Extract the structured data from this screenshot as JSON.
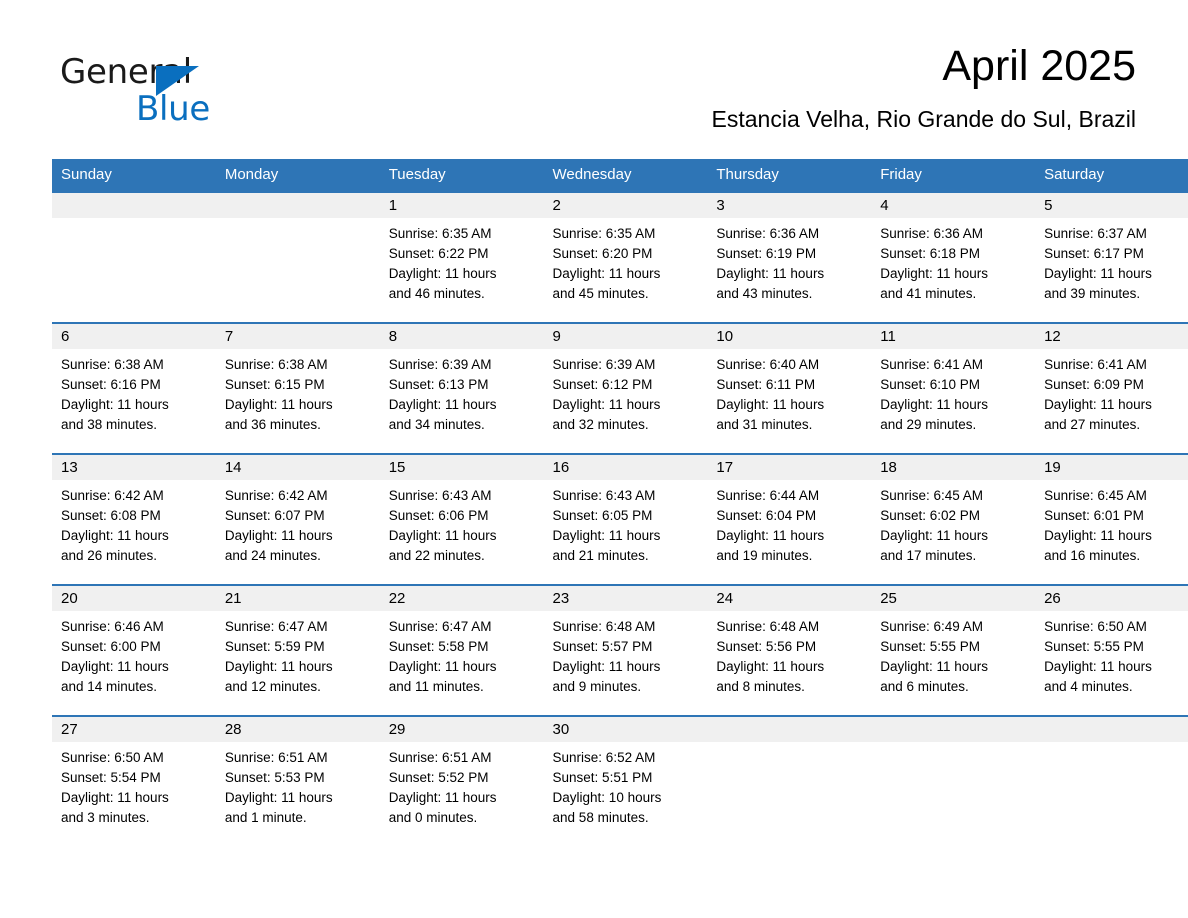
{
  "logo": {
    "text_primary": "General",
    "text_secondary": "Blue",
    "primary_color": "#1a1a1a",
    "secondary_color": "#0A6FBF"
  },
  "header": {
    "title": "April 2025",
    "subtitle": "Estancia Velha, Rio Grande do Sul, Brazil"
  },
  "theme": {
    "header_blue": "#2E75B6",
    "daynum_band_gray": "#F0F0F0",
    "row_divider_blue": "#2E75B6",
    "text_black": "#000000",
    "page_background": "#FFFFFF"
  },
  "calendar": {
    "weekday_headers": [
      "Sunday",
      "Monday",
      "Tuesday",
      "Wednesday",
      "Thursday",
      "Friday",
      "Saturday"
    ],
    "weeks": [
      [
        {
          "day": "",
          "lines": []
        },
        {
          "day": "",
          "lines": []
        },
        {
          "day": "1",
          "lines": [
            "Sunrise: 6:35 AM",
            "Sunset: 6:22 PM",
            "Daylight: 11 hours",
            "and 46 minutes."
          ]
        },
        {
          "day": "2",
          "lines": [
            "Sunrise: 6:35 AM",
            "Sunset: 6:20 PM",
            "Daylight: 11 hours",
            "and 45 minutes."
          ]
        },
        {
          "day": "3",
          "lines": [
            "Sunrise: 6:36 AM",
            "Sunset: 6:19 PM",
            "Daylight: 11 hours",
            "and 43 minutes."
          ]
        },
        {
          "day": "4",
          "lines": [
            "Sunrise: 6:36 AM",
            "Sunset: 6:18 PM",
            "Daylight: 11 hours",
            "and 41 minutes."
          ]
        },
        {
          "day": "5",
          "lines": [
            "Sunrise: 6:37 AM",
            "Sunset: 6:17 PM",
            "Daylight: 11 hours",
            "and 39 minutes."
          ]
        }
      ],
      [
        {
          "day": "6",
          "lines": [
            "Sunrise: 6:38 AM",
            "Sunset: 6:16 PM",
            "Daylight: 11 hours",
            "and 38 minutes."
          ]
        },
        {
          "day": "7",
          "lines": [
            "Sunrise: 6:38 AM",
            "Sunset: 6:15 PM",
            "Daylight: 11 hours",
            "and 36 minutes."
          ]
        },
        {
          "day": "8",
          "lines": [
            "Sunrise: 6:39 AM",
            "Sunset: 6:13 PM",
            "Daylight: 11 hours",
            "and 34 minutes."
          ]
        },
        {
          "day": "9",
          "lines": [
            "Sunrise: 6:39 AM",
            "Sunset: 6:12 PM",
            "Daylight: 11 hours",
            "and 32 minutes."
          ]
        },
        {
          "day": "10",
          "lines": [
            "Sunrise: 6:40 AM",
            "Sunset: 6:11 PM",
            "Daylight: 11 hours",
            "and 31 minutes."
          ]
        },
        {
          "day": "11",
          "lines": [
            "Sunrise: 6:41 AM",
            "Sunset: 6:10 PM",
            "Daylight: 11 hours",
            "and 29 minutes."
          ]
        },
        {
          "day": "12",
          "lines": [
            "Sunrise: 6:41 AM",
            "Sunset: 6:09 PM",
            "Daylight: 11 hours",
            "and 27 minutes."
          ]
        }
      ],
      [
        {
          "day": "13",
          "lines": [
            "Sunrise: 6:42 AM",
            "Sunset: 6:08 PM",
            "Daylight: 11 hours",
            "and 26 minutes."
          ]
        },
        {
          "day": "14",
          "lines": [
            "Sunrise: 6:42 AM",
            "Sunset: 6:07 PM",
            "Daylight: 11 hours",
            "and 24 minutes."
          ]
        },
        {
          "day": "15",
          "lines": [
            "Sunrise: 6:43 AM",
            "Sunset: 6:06 PM",
            "Daylight: 11 hours",
            "and 22 minutes."
          ]
        },
        {
          "day": "16",
          "lines": [
            "Sunrise: 6:43 AM",
            "Sunset: 6:05 PM",
            "Daylight: 11 hours",
            "and 21 minutes."
          ]
        },
        {
          "day": "17",
          "lines": [
            "Sunrise: 6:44 AM",
            "Sunset: 6:04 PM",
            "Daylight: 11 hours",
            "and 19 minutes."
          ]
        },
        {
          "day": "18",
          "lines": [
            "Sunrise: 6:45 AM",
            "Sunset: 6:02 PM",
            "Daylight: 11 hours",
            "and 17 minutes."
          ]
        },
        {
          "day": "19",
          "lines": [
            "Sunrise: 6:45 AM",
            "Sunset: 6:01 PM",
            "Daylight: 11 hours",
            "and 16 minutes."
          ]
        }
      ],
      [
        {
          "day": "20",
          "lines": [
            "Sunrise: 6:46 AM",
            "Sunset: 6:00 PM",
            "Daylight: 11 hours",
            "and 14 minutes."
          ]
        },
        {
          "day": "21",
          "lines": [
            "Sunrise: 6:47 AM",
            "Sunset: 5:59 PM",
            "Daylight: 11 hours",
            "and 12 minutes."
          ]
        },
        {
          "day": "22",
          "lines": [
            "Sunrise: 6:47 AM",
            "Sunset: 5:58 PM",
            "Daylight: 11 hours",
            "and 11 minutes."
          ]
        },
        {
          "day": "23",
          "lines": [
            "Sunrise: 6:48 AM",
            "Sunset: 5:57 PM",
            "Daylight: 11 hours",
            "and 9 minutes."
          ]
        },
        {
          "day": "24",
          "lines": [
            "Sunrise: 6:48 AM",
            "Sunset: 5:56 PM",
            "Daylight: 11 hours",
            "and 8 minutes."
          ]
        },
        {
          "day": "25",
          "lines": [
            "Sunrise: 6:49 AM",
            "Sunset: 5:55 PM",
            "Daylight: 11 hours",
            "and 6 minutes."
          ]
        },
        {
          "day": "26",
          "lines": [
            "Sunrise: 6:50 AM",
            "Sunset: 5:55 PM",
            "Daylight: 11 hours",
            "and 4 minutes."
          ]
        }
      ],
      [
        {
          "day": "27",
          "lines": [
            "Sunrise: 6:50 AM",
            "Sunset: 5:54 PM",
            "Daylight: 11 hours",
            "and 3 minutes."
          ]
        },
        {
          "day": "28",
          "lines": [
            "Sunrise: 6:51 AM",
            "Sunset: 5:53 PM",
            "Daylight: 11 hours",
            "and 1 minute."
          ]
        },
        {
          "day": "29",
          "lines": [
            "Sunrise: 6:51 AM",
            "Sunset: 5:52 PM",
            "Daylight: 11 hours",
            "and 0 minutes."
          ]
        },
        {
          "day": "30",
          "lines": [
            "Sunrise: 6:52 AM",
            "Sunset: 5:51 PM",
            "Daylight: 10 hours",
            "and 58 minutes."
          ]
        },
        {
          "day": "",
          "lines": []
        },
        {
          "day": "",
          "lines": []
        },
        {
          "day": "",
          "lines": []
        }
      ]
    ]
  }
}
